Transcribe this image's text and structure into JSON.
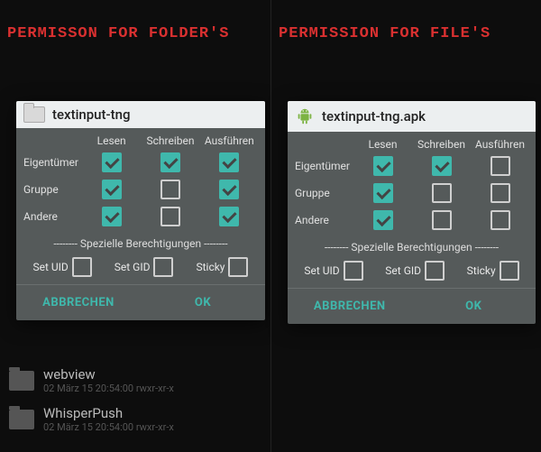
{
  "left": {
    "banner": "PERMISSON FOR FOLDER'S",
    "dialog": {
      "title": "textinput-tng",
      "icon": "folder",
      "cols": {
        "read": "Lesen",
        "write": "Schreiben",
        "exec": "Ausführen"
      },
      "rows": {
        "owner": {
          "label": "Eigentümer",
          "read": true,
          "write": true,
          "exec": true
        },
        "group": {
          "label": "Gruppe",
          "read": true,
          "write": false,
          "exec": true
        },
        "other": {
          "label": "Andere",
          "read": true,
          "write": false,
          "exec": true
        }
      },
      "special": {
        "title": "-------- Spezielle Berechtigungen --------",
        "setuid": {
          "label": "Set UID",
          "on": false
        },
        "setgid": {
          "label": "Set GID",
          "on": false
        },
        "sticky": {
          "label": "Sticky",
          "on": false
        }
      },
      "cancel": "ABBRECHEN",
      "ok": "OK"
    },
    "bg": [
      {
        "name": "webview",
        "meta": "02 März 15 20:54:00  rwxr-xr-x"
      },
      {
        "name": "WhisperPush",
        "meta": "02 März 15 20:54:00  rwxr-xr-x"
      }
    ]
  },
  "right": {
    "banner": "PERMISSION FOR FILE'S",
    "dialog": {
      "title": "textinput-tng.apk",
      "icon": "apk",
      "cols": {
        "read": "Lesen",
        "write": "Schreiben",
        "exec": "Ausführen"
      },
      "rows": {
        "owner": {
          "label": "Eigentümer",
          "read": true,
          "write": true,
          "exec": false
        },
        "group": {
          "label": "Gruppe",
          "read": true,
          "write": false,
          "exec": false
        },
        "other": {
          "label": "Andere",
          "read": true,
          "write": false,
          "exec": false
        }
      },
      "special": {
        "title": "-------- Spezielle Berechtigungen --------",
        "setuid": {
          "label": "Set UID",
          "on": false
        },
        "setgid": {
          "label": "Set GID",
          "on": false
        },
        "sticky": {
          "label": "Sticky",
          "on": false
        }
      },
      "cancel": "ABBRECHEN",
      "ok": "OK"
    }
  }
}
